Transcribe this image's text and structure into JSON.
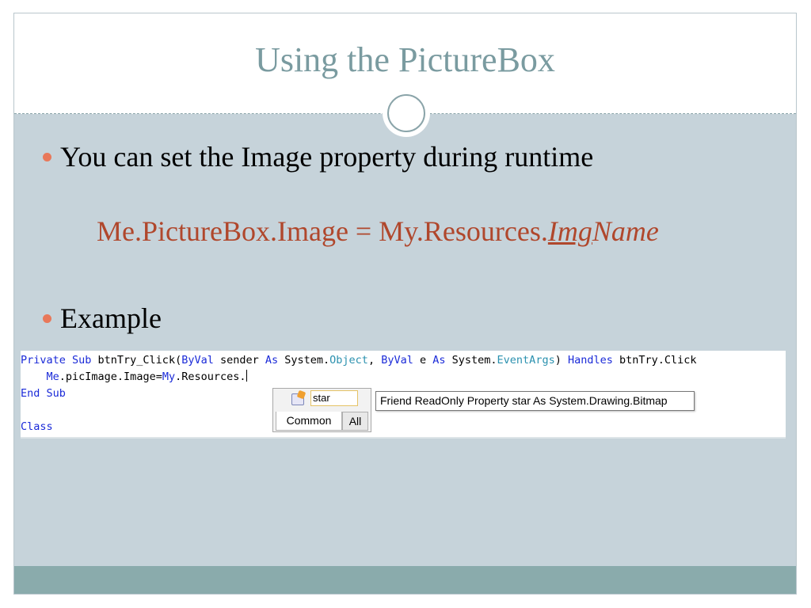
{
  "slide": {
    "title": "Using the PictureBox",
    "bullets": [
      "You can set the Image property during runtime",
      "Example"
    ],
    "code_example": {
      "prefix": "Me.PictureBox.Image = My.Resources.",
      "underlined": "Img",
      "suffix": "Name"
    }
  },
  "code_screenshot": {
    "line1": {
      "t1": "Private Sub",
      "t2": " btnTry_Click(",
      "t3": "ByVal",
      "t4": " sender ",
      "t5": "As",
      "t6": " System.",
      "t7": "Object",
      "t8": ", ",
      "t9": "ByVal",
      "t10": " e ",
      "t11": "As",
      "t12": " System.",
      "t13": "EventArgs",
      "t14": ") ",
      "t15": "Handles",
      "t16": " btnTry.Click"
    },
    "line2": {
      "t1": "    Me",
      "t2": ".picImage.Image=",
      "t3": "My",
      "t4": ".Resources."
    },
    "line3": "End Sub",
    "line4": "Class",
    "intellisense": {
      "item": "star",
      "item_icon": "property-icon",
      "tab_common": "Common",
      "tab_all": "All"
    },
    "tooltip": "Friend ReadOnly Property star As System.Drawing.Bitmap"
  },
  "colors": {
    "title": "#7a9ba0",
    "bullet": "#e8785a",
    "code_red": "#b0472c",
    "keyword_blue": "#1a2ad8",
    "type_teal": "#2b91af",
    "footer": "#8aabac",
    "content_bg": "#c6d3da"
  }
}
